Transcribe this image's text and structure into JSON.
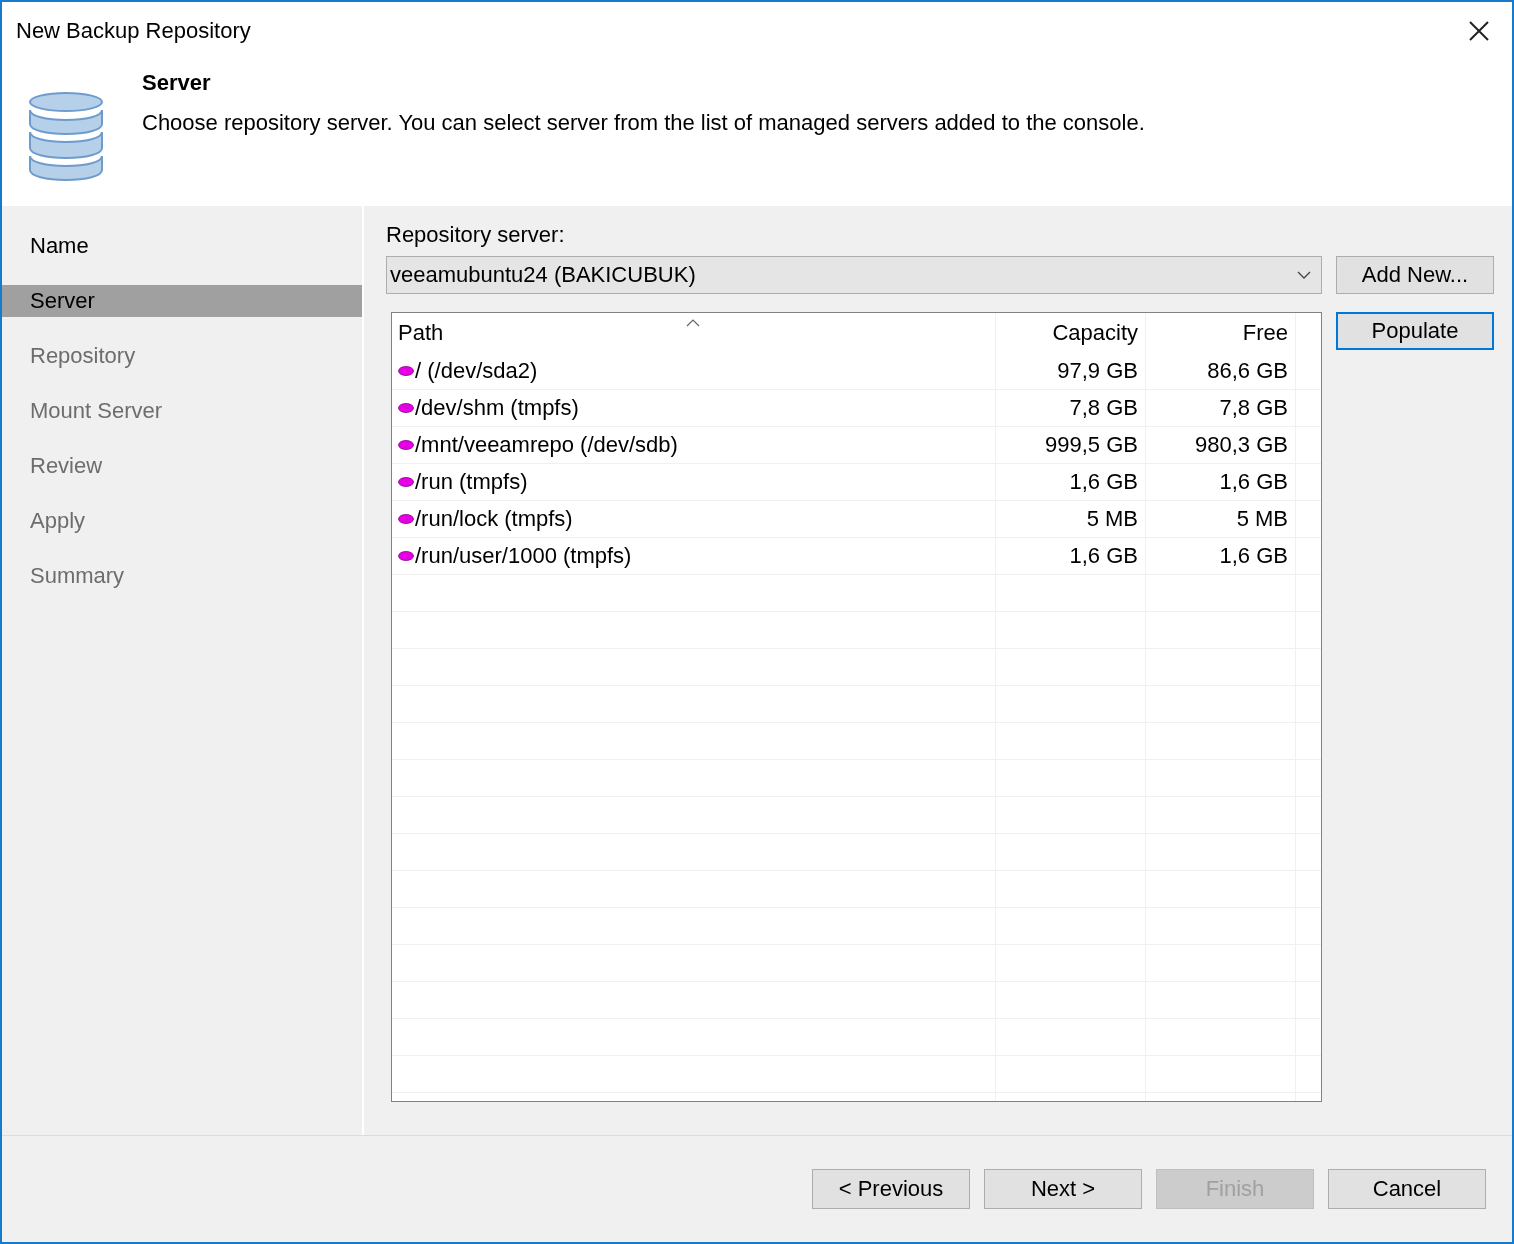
{
  "window": {
    "title": "New Backup Repository"
  },
  "header": {
    "title": "Server",
    "description": "Choose repository server. You can select server from the list of managed servers added to the console."
  },
  "steps": [
    {
      "label": "Name",
      "selected": false,
      "disabled": false
    },
    {
      "label": "Server",
      "selected": true,
      "disabled": false
    },
    {
      "label": "Repository",
      "selected": false,
      "disabled": true
    },
    {
      "label": "Mount Server",
      "selected": false,
      "disabled": true
    },
    {
      "label": "Review",
      "selected": false,
      "disabled": true
    },
    {
      "label": "Apply",
      "selected": false,
      "disabled": true
    },
    {
      "label": "Summary",
      "selected": false,
      "disabled": true
    }
  ],
  "server": {
    "label": "Repository server:",
    "value": "veeamubuntu24 (BAKICUBUK)",
    "add_button": "Add New...",
    "populate_button": "Populate"
  },
  "table": {
    "columns": [
      "Path",
      "Capacity",
      "Free"
    ],
    "rows": [
      {
        "path": "/ (/dev/sda2)",
        "capacity": "97,9 GB",
        "free": "86,6 GB"
      },
      {
        "path": "/dev/shm (tmpfs)",
        "capacity": "7,8 GB",
        "free": "7,8 GB"
      },
      {
        "path": "/mnt/veeamrepo (/dev/sdb)",
        "capacity": "999,5 GB",
        "free": "980,3 GB"
      },
      {
        "path": "/run (tmpfs)",
        "capacity": "1,6 GB",
        "free": "1,6 GB"
      },
      {
        "path": "/run/lock (tmpfs)",
        "capacity": "5 MB",
        "free": "5 MB"
      },
      {
        "path": "/run/user/1000 (tmpfs)",
        "capacity": "1,6 GB",
        "free": "1,6 GB"
      }
    ]
  },
  "buttons": [
    {
      "label": "< Previous",
      "disabled": false
    },
    {
      "label": "Next >",
      "disabled": false
    },
    {
      "label": "Finish",
      "disabled": true
    },
    {
      "label": "Cancel",
      "disabled": false
    }
  ]
}
